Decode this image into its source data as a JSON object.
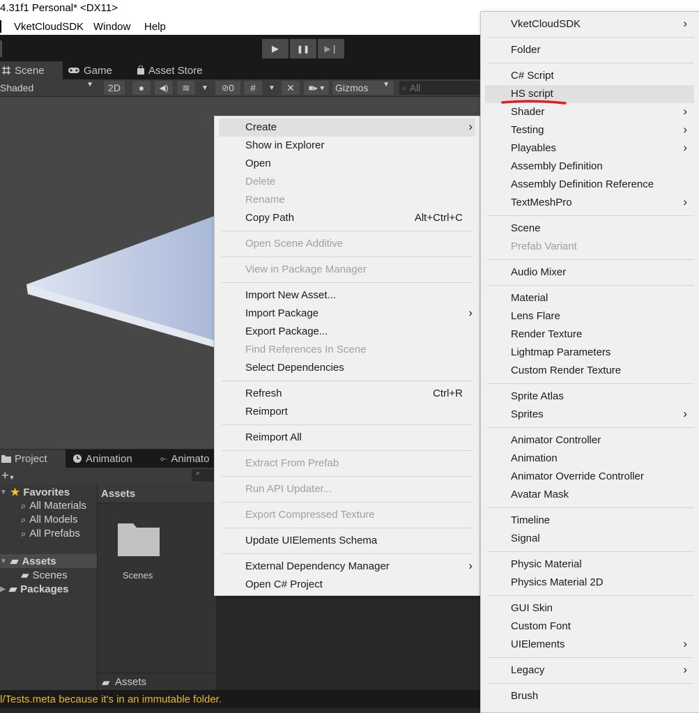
{
  "title_bar": {
    "text": "4.31f1 Personal* <DX11>"
  },
  "menu_bar": {
    "items": [
      "VketCloudSDK",
      "Window",
      "Help"
    ]
  },
  "play_controls": {
    "play": "▶",
    "pause": "❚❚",
    "step": "▶❙"
  },
  "scene_tabs": {
    "scene": "Scene",
    "game": "Game",
    "asset_store": "Asset Store"
  },
  "scene_toolbar": {
    "shading": "Shaded",
    "mode_2d": "2D",
    "hidden_count": "0",
    "gizmos": "Gizmos",
    "search_placeholder": "All"
  },
  "bottom_tabs": {
    "project": "Project",
    "animation": "Animation",
    "animator": "Animato"
  },
  "project": {
    "favorites": "Favorites",
    "favorite_items": [
      "All Materials",
      "All Models",
      "All Prefabs"
    ],
    "assets": "Assets",
    "scenes": "Scenes",
    "packages": "Packages",
    "assets_header": "Assets",
    "folder_label": "Scenes",
    "breadcrumb": "Assets"
  },
  "status_bar": {
    "text": "l/Tests.meta because it's in an immutable folder."
  },
  "context_menu": [
    {
      "label": "Create",
      "submenu": true,
      "highlight": true
    },
    {
      "label": "Show in Explorer"
    },
    {
      "label": "Open"
    },
    {
      "label": "Delete",
      "disabled": true
    },
    {
      "label": "Rename",
      "disabled": true
    },
    {
      "label": "Copy Path",
      "shortcut": "Alt+Ctrl+C"
    },
    {
      "sep": true
    },
    {
      "label": "Open Scene Additive",
      "disabled": true
    },
    {
      "sep": true
    },
    {
      "label": "View in Package Manager",
      "disabled": true
    },
    {
      "sep": true
    },
    {
      "label": "Import New Asset..."
    },
    {
      "label": "Import Package",
      "submenu": true
    },
    {
      "label": "Export Package..."
    },
    {
      "label": "Find References In Scene",
      "disabled": true
    },
    {
      "label": "Select Dependencies"
    },
    {
      "sep": true
    },
    {
      "label": "Refresh",
      "shortcut": "Ctrl+R"
    },
    {
      "label": "Reimport"
    },
    {
      "sep": true
    },
    {
      "label": "Reimport All"
    },
    {
      "sep": true
    },
    {
      "label": "Extract From Prefab",
      "disabled": true
    },
    {
      "sep": true
    },
    {
      "label": "Run API Updater...",
      "disabled": true
    },
    {
      "sep": true
    },
    {
      "label": "Export Compressed Texture",
      "disabled": true
    },
    {
      "sep": true
    },
    {
      "label": "Update UIElements Schema"
    },
    {
      "sep": true
    },
    {
      "label": "External Dependency Manager",
      "submenu": true
    },
    {
      "label": "Open C# Project"
    }
  ],
  "create_submenu": [
    {
      "label": "VketCloudSDK",
      "submenu": true
    },
    {
      "sep": true
    },
    {
      "label": "Folder"
    },
    {
      "sep": true
    },
    {
      "label": "C# Script"
    },
    {
      "label": "HS script",
      "highlight": true,
      "annotated": true
    },
    {
      "label": "Shader",
      "submenu": true
    },
    {
      "label": "Testing",
      "submenu": true
    },
    {
      "label": "Playables",
      "submenu": true
    },
    {
      "label": "Assembly Definition"
    },
    {
      "label": "Assembly Definition Reference"
    },
    {
      "label": "TextMeshPro",
      "submenu": true
    },
    {
      "sep": true
    },
    {
      "label": "Scene"
    },
    {
      "label": "Prefab Variant",
      "disabled": true
    },
    {
      "sep": true
    },
    {
      "label": "Audio Mixer"
    },
    {
      "sep": true
    },
    {
      "label": "Material"
    },
    {
      "label": "Lens Flare"
    },
    {
      "label": "Render Texture"
    },
    {
      "label": "Lightmap Parameters"
    },
    {
      "label": "Custom Render Texture"
    },
    {
      "sep": true
    },
    {
      "label": "Sprite Atlas"
    },
    {
      "label": "Sprites",
      "submenu": true
    },
    {
      "sep": true
    },
    {
      "label": "Animator Controller"
    },
    {
      "label": "Animation"
    },
    {
      "label": "Animator Override Controller"
    },
    {
      "label": "Avatar Mask"
    },
    {
      "sep": true
    },
    {
      "label": "Timeline"
    },
    {
      "label": "Signal"
    },
    {
      "sep": true
    },
    {
      "label": "Physic Material"
    },
    {
      "label": "Physics Material 2D"
    },
    {
      "sep": true
    },
    {
      "label": "GUI Skin"
    },
    {
      "label": "Custom Font"
    },
    {
      "label": "UIElements",
      "submenu": true
    },
    {
      "sep": true
    },
    {
      "label": "Legacy",
      "submenu": true
    },
    {
      "sep": true
    },
    {
      "label": "Brush"
    }
  ],
  "colors": {
    "annotation": "#e02020",
    "status_text": "#e8b931",
    "menu_bg": "#f0f0f0",
    "editor_dark": "#282828"
  }
}
